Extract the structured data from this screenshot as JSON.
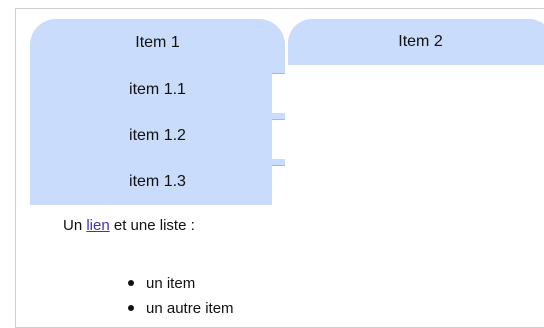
{
  "menu": {
    "items": [
      {
        "label": "Item 1",
        "subitems": [
          "item 1.1",
          "item 1.2",
          "item 1.3"
        ]
      },
      {
        "label": "Item 2"
      }
    ]
  },
  "content": {
    "prefix": "Un ",
    "link_text": "lien",
    "suffix": " et une liste :",
    "list_items": [
      "un item",
      "un autre item"
    ]
  }
}
